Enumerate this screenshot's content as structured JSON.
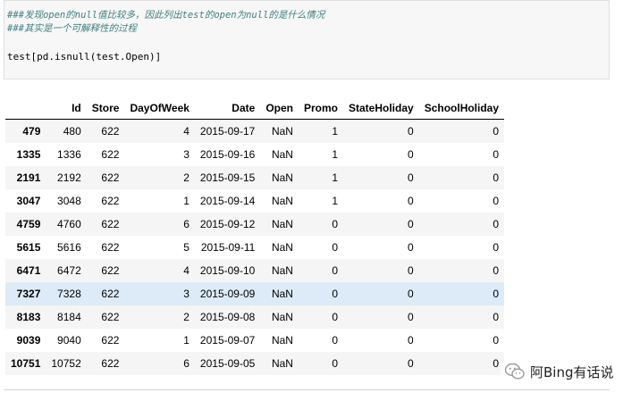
{
  "code_cell": {
    "comment_line_1": "###发现open的null值比较多，因此列出test的open为null的是什么情况",
    "comment_line_2": "###其实是一个可解释性的过程",
    "code_line": "test[pd.isnull(test.Open)]"
  },
  "table": {
    "columns": [
      "",
      "Id",
      "Store",
      "DayOfWeek",
      "Date",
      "Open",
      "Promo",
      "StateHoliday",
      "SchoolHoliday"
    ],
    "rows": [
      [
        "479",
        "480",
        "622",
        "4",
        "2015-09-17",
        "NaN",
        "1",
        "0",
        "0"
      ],
      [
        "1335",
        "1336",
        "622",
        "3",
        "2015-09-16",
        "NaN",
        "1",
        "0",
        "0"
      ],
      [
        "2191",
        "2192",
        "622",
        "2",
        "2015-09-15",
        "NaN",
        "1",
        "0",
        "0"
      ],
      [
        "3047",
        "3048",
        "622",
        "1",
        "2015-09-14",
        "NaN",
        "1",
        "0",
        "0"
      ],
      [
        "4759",
        "4760",
        "622",
        "6",
        "2015-09-12",
        "NaN",
        "0",
        "0",
        "0"
      ],
      [
        "5615",
        "5616",
        "622",
        "5",
        "2015-09-11",
        "NaN",
        "0",
        "0",
        "0"
      ],
      [
        "6471",
        "6472",
        "622",
        "4",
        "2015-09-10",
        "NaN",
        "0",
        "0",
        "0"
      ],
      [
        "7327",
        "7328",
        "622",
        "3",
        "2015-09-09",
        "NaN",
        "0",
        "0",
        "0"
      ],
      [
        "8183",
        "8184",
        "622",
        "2",
        "2015-09-08",
        "NaN",
        "0",
        "0",
        "0"
      ],
      [
        "9039",
        "9040",
        "622",
        "1",
        "2015-09-07",
        "NaN",
        "0",
        "0",
        "0"
      ],
      [
        "10751",
        "10752",
        "622",
        "6",
        "2015-09-05",
        "NaN",
        "0",
        "0",
        "0"
      ]
    ],
    "highlighted_row_index": 7,
    "highlight_color": "#dcebf7"
  },
  "watermark": {
    "text": "阿Bing有话说",
    "icon": "wechat-icon"
  }
}
